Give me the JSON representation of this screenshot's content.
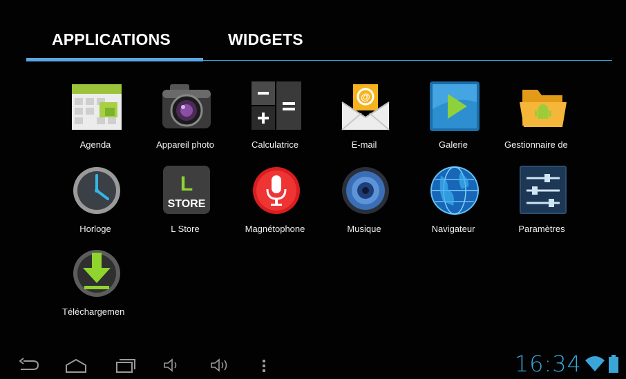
{
  "tabs": {
    "applications": "APPLICATIONS",
    "widgets": "WIDGETS",
    "active": "applications"
  },
  "apps": [
    {
      "label": "Agenda",
      "icon": "calendar-icon"
    },
    {
      "label": "Appareil photo",
      "icon": "camera-icon"
    },
    {
      "label": "Calculatrice",
      "icon": "calculator-icon"
    },
    {
      "label": "E-mail",
      "icon": "email-icon"
    },
    {
      "label": "Galerie",
      "icon": "gallery-icon"
    },
    {
      "label": "Gestionnaire de",
      "icon": "file-manager-icon"
    },
    {
      "label": "Horloge",
      "icon": "clock-icon"
    },
    {
      "label": "L Store",
      "icon": "lstore-icon"
    },
    {
      "label": "Magnétophone",
      "icon": "microphone-icon"
    },
    {
      "label": "Musique",
      "icon": "music-speaker-icon"
    },
    {
      "label": "Navigateur",
      "icon": "globe-icon"
    },
    {
      "label": "Paramètres",
      "icon": "settings-sliders-icon"
    },
    {
      "label": "Téléchargemen",
      "icon": "download-icon"
    }
  ],
  "store_icon_text": {
    "letter": "L",
    "word": "STORE"
  },
  "status": {
    "time": "16:34",
    "wifi": "wifi-icon",
    "battery": "battery-icon"
  },
  "navbar": [
    "back-icon",
    "home-icon",
    "recent-apps-icon",
    "volume-down-icon",
    "volume-up-icon",
    "menu-icon"
  ],
  "colors": {
    "accent": "#33b5e5",
    "tab_indicator": "#5aa7e2",
    "background": "#020203"
  }
}
